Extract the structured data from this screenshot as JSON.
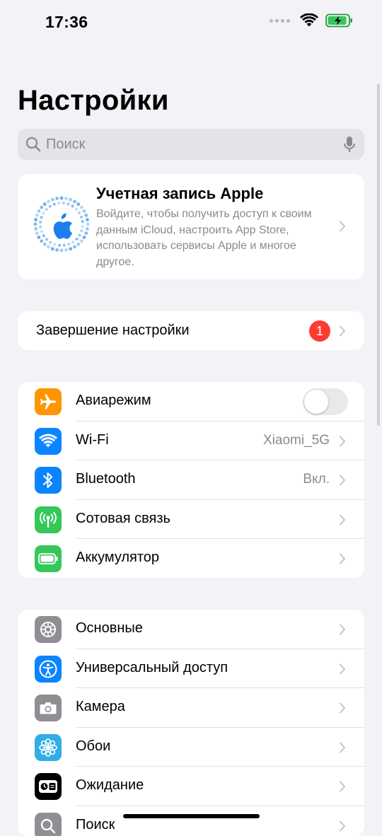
{
  "status_bar": {
    "time": "17:36"
  },
  "title": "Настройки",
  "search": {
    "placeholder": "Поиск"
  },
  "account": {
    "title": "Учетная запись Apple",
    "description": "Войдите, чтобы получить доступ к своим данным iCloud, настроить App Store, использовать сервисы Apple и многое другое."
  },
  "setup": {
    "label": "Завершение настройки",
    "badge": "1"
  },
  "connectivity": {
    "items": [
      {
        "label": "Авиарежим",
        "icon": "airplane-icon",
        "color": "#ff9500",
        "toggle_on": false
      },
      {
        "label": "Wi-Fi",
        "value": "Xiaomi_5G",
        "icon": "wifi-icon",
        "color": "#0a84ff"
      },
      {
        "label": "Bluetooth",
        "value": "Вкл.",
        "icon": "bluetooth-icon",
        "color": "#0a84ff"
      },
      {
        "label": "Сотовая связь",
        "icon": "cellular-icon",
        "color": "#34c759"
      },
      {
        "label": "Аккумулятор",
        "icon": "battery-icon",
        "color": "#34c759"
      }
    ]
  },
  "general": {
    "items": [
      {
        "label": "Основные",
        "icon": "gear-icon",
        "color": "#8e8e93"
      },
      {
        "label": "Универсальный доступ",
        "icon": "accessibility-icon",
        "color": "#0a84ff"
      },
      {
        "label": "Камера",
        "icon": "camera-icon",
        "color": "#8e8e93"
      },
      {
        "label": "Обои",
        "icon": "wallpaper-icon",
        "color": "#32ade6"
      },
      {
        "label": "Ожидание",
        "icon": "standby-icon",
        "color": "#000000"
      },
      {
        "label": "Поиск",
        "icon": "search-icon",
        "color": "#8e8e93"
      }
    ]
  }
}
